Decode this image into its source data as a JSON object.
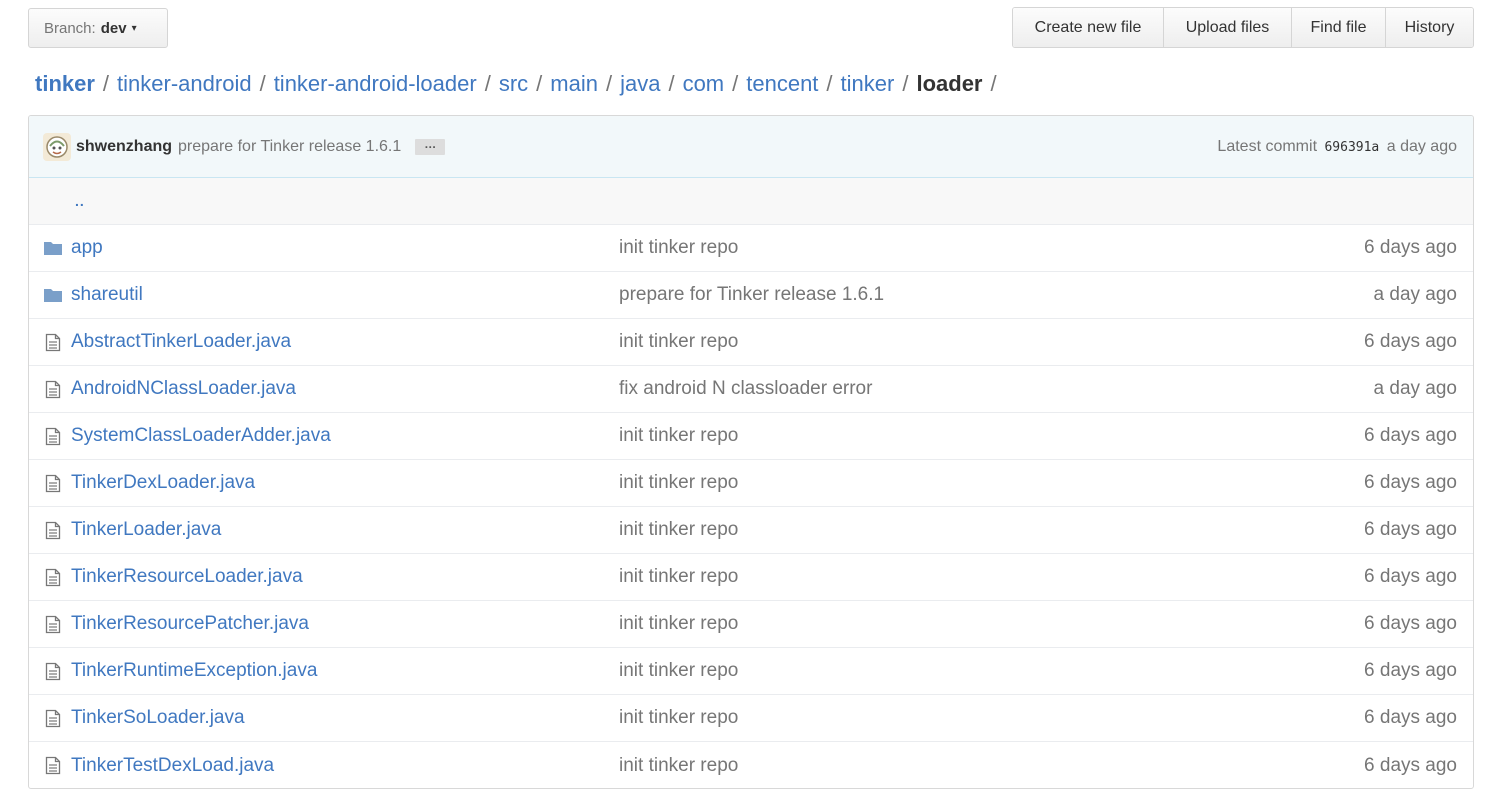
{
  "branch": {
    "prefix": "Branch:",
    "name": "dev",
    "caret": "▾"
  },
  "actions": {
    "create_new_file": "Create new file",
    "upload_files": "Upload files",
    "find_file": "Find file",
    "history": "History"
  },
  "breadcrumb": {
    "parts": [
      "tinker",
      "tinker-android",
      "tinker-android-loader",
      "src",
      "main",
      "java",
      "com",
      "tencent",
      "tinker"
    ],
    "current": "loader",
    "separator": "/"
  },
  "commit": {
    "author": "shwenzhang",
    "message": "prepare for Tinker release 1.6.1",
    "ellipsis": "…",
    "latest_label": "Latest commit",
    "sha": "696391a",
    "age": "a day ago"
  },
  "parent_dir": "..",
  "files": [
    {
      "type": "dir",
      "name": "app",
      "message": "init tinker repo",
      "age": "6 days ago"
    },
    {
      "type": "dir",
      "name": "shareutil",
      "message": "prepare for Tinker release 1.6.1",
      "age": "a day ago"
    },
    {
      "type": "file",
      "name": "AbstractTinkerLoader.java",
      "message": "init tinker repo",
      "age": "6 days ago"
    },
    {
      "type": "file",
      "name": "AndroidNClassLoader.java",
      "message": "fix android N classloader error",
      "age": "a day ago"
    },
    {
      "type": "file",
      "name": "SystemClassLoaderAdder.java",
      "message": "init tinker repo",
      "age": "6 days ago"
    },
    {
      "type": "file",
      "name": "TinkerDexLoader.java",
      "message": "init tinker repo",
      "age": "6 days ago"
    },
    {
      "type": "file",
      "name": "TinkerLoader.java",
      "message": "init tinker repo",
      "age": "6 days ago"
    },
    {
      "type": "file",
      "name": "TinkerResourceLoader.java",
      "message": "init tinker repo",
      "age": "6 days ago"
    },
    {
      "type": "file",
      "name": "TinkerResourcePatcher.java",
      "message": "init tinker repo",
      "age": "6 days ago"
    },
    {
      "type": "file",
      "name": "TinkerRuntimeException.java",
      "message": "init tinker repo",
      "age": "6 days ago"
    },
    {
      "type": "file",
      "name": "TinkerSoLoader.java",
      "message": "init tinker repo",
      "age": "6 days ago"
    },
    {
      "type": "file",
      "name": "TinkerTestDexLoad.java",
      "message": "init tinker repo",
      "age": "6 days ago"
    }
  ],
  "colors": {
    "link": "#4078c0",
    "muted": "#767676",
    "commit_bar_bg": "#f2f8fa",
    "folder_icon": "#7a9fc9",
    "file_icon": "#777777"
  }
}
